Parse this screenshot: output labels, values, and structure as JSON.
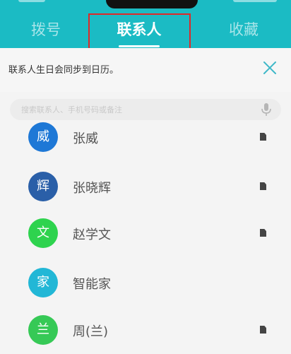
{
  "tabs": [
    {
      "label": "拨号",
      "active": false
    },
    {
      "label": "联系人",
      "active": true
    },
    {
      "label": "收藏",
      "active": false
    }
  ],
  "notice": {
    "text": "联系人生日会同步到日历。"
  },
  "search": {
    "placeholder": "搜索联系人、手机号码或备注"
  },
  "contacts": [
    {
      "avatar_char": "威",
      "name": "张威",
      "color": "#1e78d6"
    },
    {
      "avatar_char": "辉",
      "name": "张晓辉",
      "color": "#2a5fa8"
    },
    {
      "avatar_char": "文",
      "name": "赵学文",
      "color": "#2ed34e"
    },
    {
      "avatar_char": "家",
      "name": "智能家",
      "color": "#22b7d6"
    },
    {
      "avatar_char": "兰",
      "name": "周(兰)",
      "color": "#36c956"
    }
  ],
  "colors": {
    "header": "#1bbbc4",
    "highlight": "#e02828"
  },
  "icons": [
    "close-icon",
    "microphone-icon",
    "contact-card-icon"
  ]
}
